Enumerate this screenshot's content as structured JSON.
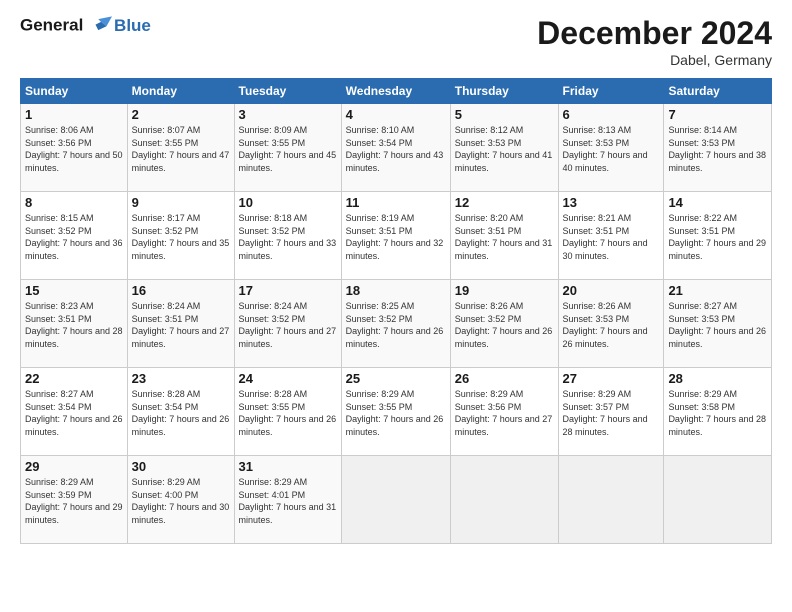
{
  "header": {
    "logo_line1": "General",
    "logo_line2": "Blue",
    "month_title": "December 2024",
    "location": "Dabel, Germany"
  },
  "days_of_week": [
    "Sunday",
    "Monday",
    "Tuesday",
    "Wednesday",
    "Thursday",
    "Friday",
    "Saturday"
  ],
  "weeks": [
    [
      {
        "day": "1",
        "sunrise": "Sunrise: 8:06 AM",
        "sunset": "Sunset: 3:56 PM",
        "daylight": "Daylight: 7 hours and 50 minutes."
      },
      {
        "day": "2",
        "sunrise": "Sunrise: 8:07 AM",
        "sunset": "Sunset: 3:55 PM",
        "daylight": "Daylight: 7 hours and 47 minutes."
      },
      {
        "day": "3",
        "sunrise": "Sunrise: 8:09 AM",
        "sunset": "Sunset: 3:55 PM",
        "daylight": "Daylight: 7 hours and 45 minutes."
      },
      {
        "day": "4",
        "sunrise": "Sunrise: 8:10 AM",
        "sunset": "Sunset: 3:54 PM",
        "daylight": "Daylight: 7 hours and 43 minutes."
      },
      {
        "day": "5",
        "sunrise": "Sunrise: 8:12 AM",
        "sunset": "Sunset: 3:53 PM",
        "daylight": "Daylight: 7 hours and 41 minutes."
      },
      {
        "day": "6",
        "sunrise": "Sunrise: 8:13 AM",
        "sunset": "Sunset: 3:53 PM",
        "daylight": "Daylight: 7 hours and 40 minutes."
      },
      {
        "day": "7",
        "sunrise": "Sunrise: 8:14 AM",
        "sunset": "Sunset: 3:53 PM",
        "daylight": "Daylight: 7 hours and 38 minutes."
      }
    ],
    [
      {
        "day": "8",
        "sunrise": "Sunrise: 8:15 AM",
        "sunset": "Sunset: 3:52 PM",
        "daylight": "Daylight: 7 hours and 36 minutes."
      },
      {
        "day": "9",
        "sunrise": "Sunrise: 8:17 AM",
        "sunset": "Sunset: 3:52 PM",
        "daylight": "Daylight: 7 hours and 35 minutes."
      },
      {
        "day": "10",
        "sunrise": "Sunrise: 8:18 AM",
        "sunset": "Sunset: 3:52 PM",
        "daylight": "Daylight: 7 hours and 33 minutes."
      },
      {
        "day": "11",
        "sunrise": "Sunrise: 8:19 AM",
        "sunset": "Sunset: 3:51 PM",
        "daylight": "Daylight: 7 hours and 32 minutes."
      },
      {
        "day": "12",
        "sunrise": "Sunrise: 8:20 AM",
        "sunset": "Sunset: 3:51 PM",
        "daylight": "Daylight: 7 hours and 31 minutes."
      },
      {
        "day": "13",
        "sunrise": "Sunrise: 8:21 AM",
        "sunset": "Sunset: 3:51 PM",
        "daylight": "Daylight: 7 hours and 30 minutes."
      },
      {
        "day": "14",
        "sunrise": "Sunrise: 8:22 AM",
        "sunset": "Sunset: 3:51 PM",
        "daylight": "Daylight: 7 hours and 29 minutes."
      }
    ],
    [
      {
        "day": "15",
        "sunrise": "Sunrise: 8:23 AM",
        "sunset": "Sunset: 3:51 PM",
        "daylight": "Daylight: 7 hours and 28 minutes."
      },
      {
        "day": "16",
        "sunrise": "Sunrise: 8:24 AM",
        "sunset": "Sunset: 3:51 PM",
        "daylight": "Daylight: 7 hours and 27 minutes."
      },
      {
        "day": "17",
        "sunrise": "Sunrise: 8:24 AM",
        "sunset": "Sunset: 3:52 PM",
        "daylight": "Daylight: 7 hours and 27 minutes."
      },
      {
        "day": "18",
        "sunrise": "Sunrise: 8:25 AM",
        "sunset": "Sunset: 3:52 PM",
        "daylight": "Daylight: 7 hours and 26 minutes."
      },
      {
        "day": "19",
        "sunrise": "Sunrise: 8:26 AM",
        "sunset": "Sunset: 3:52 PM",
        "daylight": "Daylight: 7 hours and 26 minutes."
      },
      {
        "day": "20",
        "sunrise": "Sunrise: 8:26 AM",
        "sunset": "Sunset: 3:53 PM",
        "daylight": "Daylight: 7 hours and 26 minutes."
      },
      {
        "day": "21",
        "sunrise": "Sunrise: 8:27 AM",
        "sunset": "Sunset: 3:53 PM",
        "daylight": "Daylight: 7 hours and 26 minutes."
      }
    ],
    [
      {
        "day": "22",
        "sunrise": "Sunrise: 8:27 AM",
        "sunset": "Sunset: 3:54 PM",
        "daylight": "Daylight: 7 hours and 26 minutes."
      },
      {
        "day": "23",
        "sunrise": "Sunrise: 8:28 AM",
        "sunset": "Sunset: 3:54 PM",
        "daylight": "Daylight: 7 hours and 26 minutes."
      },
      {
        "day": "24",
        "sunrise": "Sunrise: 8:28 AM",
        "sunset": "Sunset: 3:55 PM",
        "daylight": "Daylight: 7 hours and 26 minutes."
      },
      {
        "day": "25",
        "sunrise": "Sunrise: 8:29 AM",
        "sunset": "Sunset: 3:55 PM",
        "daylight": "Daylight: 7 hours and 26 minutes."
      },
      {
        "day": "26",
        "sunrise": "Sunrise: 8:29 AM",
        "sunset": "Sunset: 3:56 PM",
        "daylight": "Daylight: 7 hours and 27 minutes."
      },
      {
        "day": "27",
        "sunrise": "Sunrise: 8:29 AM",
        "sunset": "Sunset: 3:57 PM",
        "daylight": "Daylight: 7 hours and 28 minutes."
      },
      {
        "day": "28",
        "sunrise": "Sunrise: 8:29 AM",
        "sunset": "Sunset: 3:58 PM",
        "daylight": "Daylight: 7 hours and 28 minutes."
      }
    ],
    [
      {
        "day": "29",
        "sunrise": "Sunrise: 8:29 AM",
        "sunset": "Sunset: 3:59 PM",
        "daylight": "Daylight: 7 hours and 29 minutes."
      },
      {
        "day": "30",
        "sunrise": "Sunrise: 8:29 AM",
        "sunset": "Sunset: 4:00 PM",
        "daylight": "Daylight: 7 hours and 30 minutes."
      },
      {
        "day": "31",
        "sunrise": "Sunrise: 8:29 AM",
        "sunset": "Sunset: 4:01 PM",
        "daylight": "Daylight: 7 hours and 31 minutes."
      },
      null,
      null,
      null,
      null
    ]
  ]
}
